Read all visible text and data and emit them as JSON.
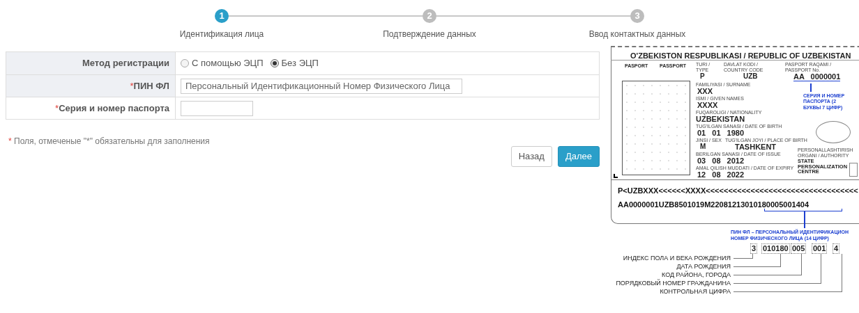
{
  "steps": [
    {
      "number": "1",
      "label": "Идентификация лица",
      "selected": true
    },
    {
      "number": "2",
      "label": "Подтверждение данных",
      "selected": false
    },
    {
      "number": "3",
      "label": "Ввод контактных данных",
      "selected": false
    }
  ],
  "form": {
    "rows": [
      {
        "kind": "radio",
        "label": "Метод регистрации",
        "required": false,
        "highlighted": true,
        "options": [
          {
            "label": "С помощью ЭЦП",
            "selected": false
          },
          {
            "label": "Без ЭЦП",
            "selected": true
          }
        ]
      },
      {
        "kind": "text",
        "label": "ПИН ФЛ",
        "required": true,
        "highlighted": true,
        "placeholder": "Персональный Идентификационный Номер Физического Лица"
      },
      {
        "kind": "short_text",
        "label": "Серия и номер паспорта",
        "required": true,
        "highlighted": false
      }
    ]
  },
  "required_note": {
    "star": "*",
    "text": "Поля, отмеченые \"*\" обязательны для заполнения"
  },
  "buttons": [
    {
      "kind": "secondary",
      "label": "Назад"
    },
    {
      "kind": "primary",
      "label": "Далее"
    }
  ],
  "passport_sample": {
    "title": "O'ZBEKISTON RESPUBLIKASI / REPUBLIC OF UZBEKISTAN",
    "doc_labels": [
      "PASPORT",
      "PASSPORT"
    ],
    "fields": [
      {
        "label": "TURI / TYPE",
        "value": "P"
      },
      {
        "label": "DAVLAT KODI / COUNTRY CODE",
        "value": "UZB"
      },
      {
        "label": "PASPORT RAQAMI / PASSPORT No.",
        "value": "AA 0000001"
      },
      {
        "label": "FAMILIYASI / SURNAME",
        "value": "XXX"
      },
      {
        "label": "ISMI / GIVEN NAMES",
        "value": "XXXX"
      },
      {
        "label": "FUQAROLIGI / NATIONALITY",
        "value": "UZBEKISTAN"
      },
      {
        "label": "TUG'ILGAN SANASI / DATE OF BIRTH",
        "value": "01 01 1980"
      },
      {
        "label": "JINSI / SEX",
        "value": "M"
      },
      {
        "label": "TUG'ILGAN JOYI / PLACE OF BIRTH",
        "value": "TASHKENT"
      },
      {
        "label": "BERILGAN SANASI / DATE OF ISSUE",
        "value": "03 08 2012"
      },
      {
        "label": "AMAL QILISH MUDDATI / DATE OF EXPIRY",
        "value": "12 08 2022"
      },
      {
        "label": "PERSONALLASHTIRISH ORGANI / AUTHORITY",
        "value": "STATE PERSONALIZATION CENTRE"
      }
    ],
    "passport_note": "СЕРИЯ И НОМЕР ПАСПОРТА (2 БУКВЫ 7 ЦИФР)",
    "mrz": [
      "P<UZBXXX<<<<<<XXXX<<<<<<<<<<<<<<<<<<<<<<<<<<<<<<<<<<",
      "AA0000001UZB8501019M22081213010180005001404"
    ],
    "pin_note": [
      "ПИН ФЛ – ПЕРСОНАЛЬНЫЙ ИДЕНТИФИКАЦИОН",
      "НОМЕР ФИЗИЧЕСКОГО ЛИЦА (14 ЦИФР)"
    ],
    "pin_groups": [
      "3",
      "010180",
      "005",
      "001",
      "4"
    ],
    "legend": [
      "ИНДЕКС ПОЛА И ВЕКА РОЖДЕНИЯ",
      "ДАТА РОЖДЕНИЯ",
      "КОД РАЙОНА, ГОРОДА",
      "ПОРЯДКОВЫЙ НОМЕР ГРАЖДАНИНА",
      "КОНТРОЛЬНАЯ ЦИФРА"
    ]
  }
}
